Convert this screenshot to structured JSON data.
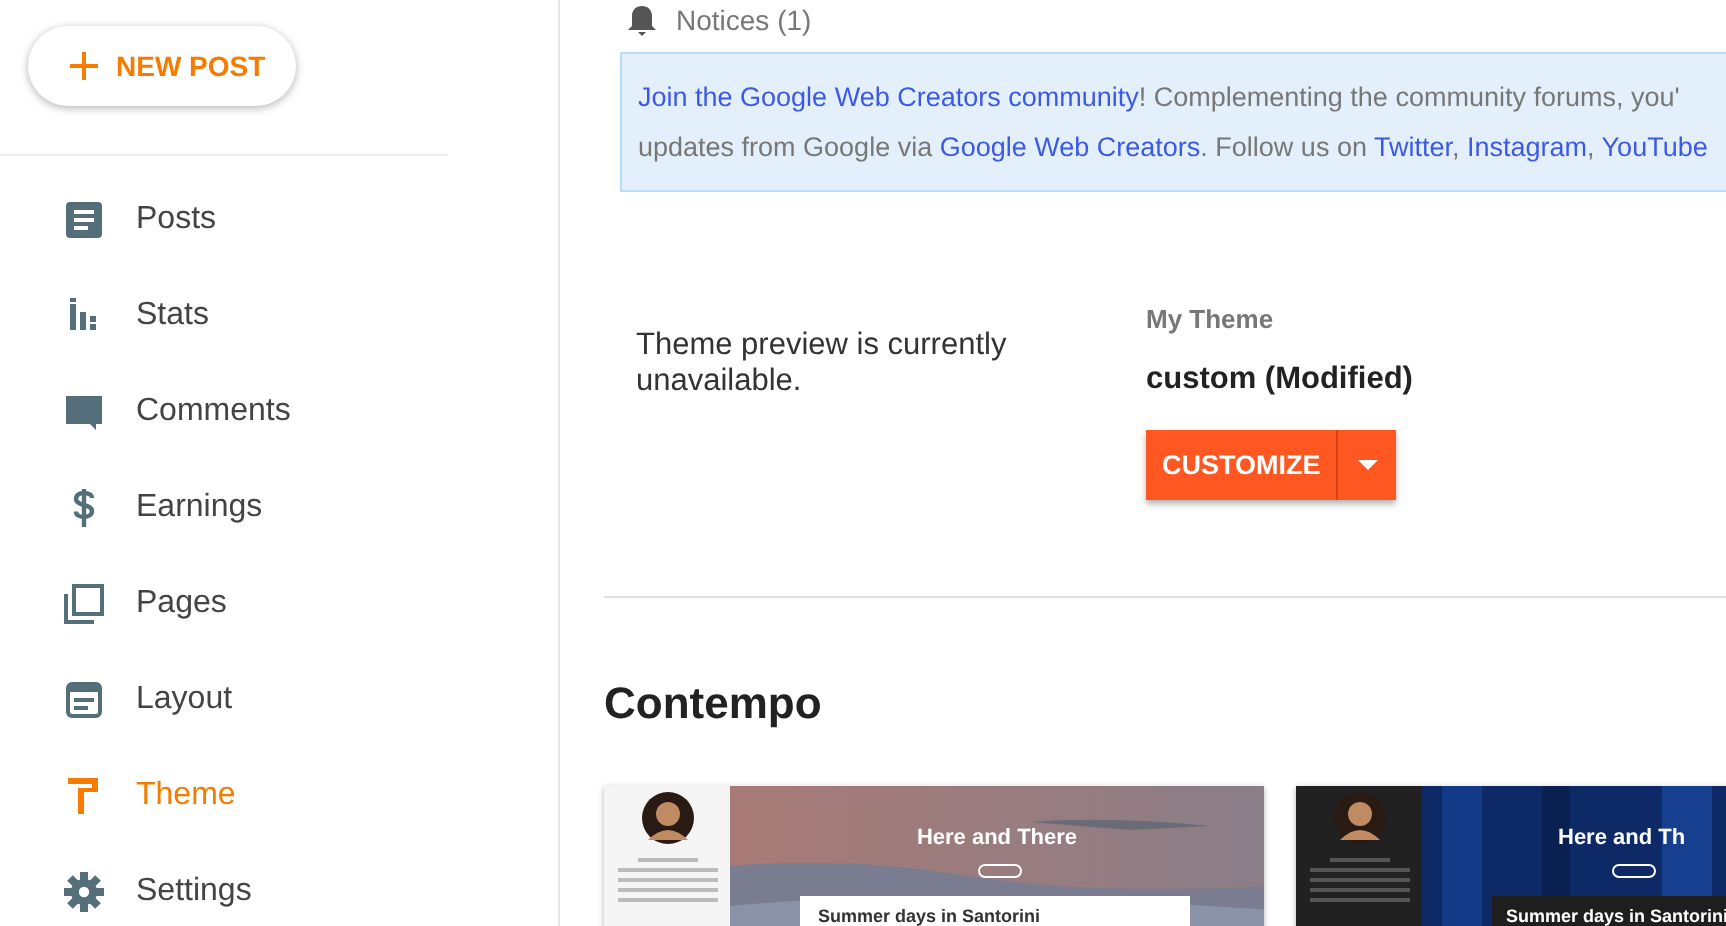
{
  "new_post_button": {
    "label": "NEW POST"
  },
  "sidebar": {
    "items": [
      {
        "kind": "posts",
        "label": "Posts",
        "selected": false
      },
      {
        "kind": "stats",
        "label": "Stats",
        "selected": false
      },
      {
        "kind": "comments",
        "label": "Comments",
        "selected": false
      },
      {
        "kind": "earnings",
        "label": "Earnings",
        "selected": false
      },
      {
        "kind": "pages",
        "label": "Pages",
        "selected": false
      },
      {
        "kind": "layout",
        "label": "Layout",
        "selected": false
      },
      {
        "kind": "theme",
        "label": "Theme",
        "selected": true
      },
      {
        "kind": "settings",
        "label": "Settings",
        "selected": false
      }
    ]
  },
  "notices": {
    "label": "Notices (1)"
  },
  "banner": {
    "lines": [
      [
        {
          "text": "Join the Google Web Creators community",
          "link": true
        },
        {
          "text": "! Complementing the community forums, you'",
          "link": false
        }
      ],
      [
        {
          "text": "updates from Google via ",
          "link": false
        },
        {
          "text": "Google Web Creators",
          "link": true
        },
        {
          "text": ". Follow us on ",
          "link": false
        },
        {
          "text": "Twitter",
          "link": true
        },
        {
          "text": ", ",
          "link": false
        },
        {
          "text": "Instagram",
          "link": true
        },
        {
          "text": ", ",
          "link": false
        },
        {
          "text": "YouTube",
          "link": true
        }
      ]
    ]
  },
  "my_theme": {
    "preview_message": "Theme preview is currently unavailable.",
    "heading": "My Theme",
    "name": "custom (Modified)",
    "customize_button": "CUSTOMIZE"
  },
  "gallery": {
    "title": "Contempo",
    "themes": [
      {
        "kind": "light",
        "blog_title": "Here and There",
        "post_title": "Summer days in Santorini"
      },
      {
        "kind": "dark",
        "blog_title": "Here and Th",
        "post_title": "Summer days in Santorini"
      }
    ]
  }
}
